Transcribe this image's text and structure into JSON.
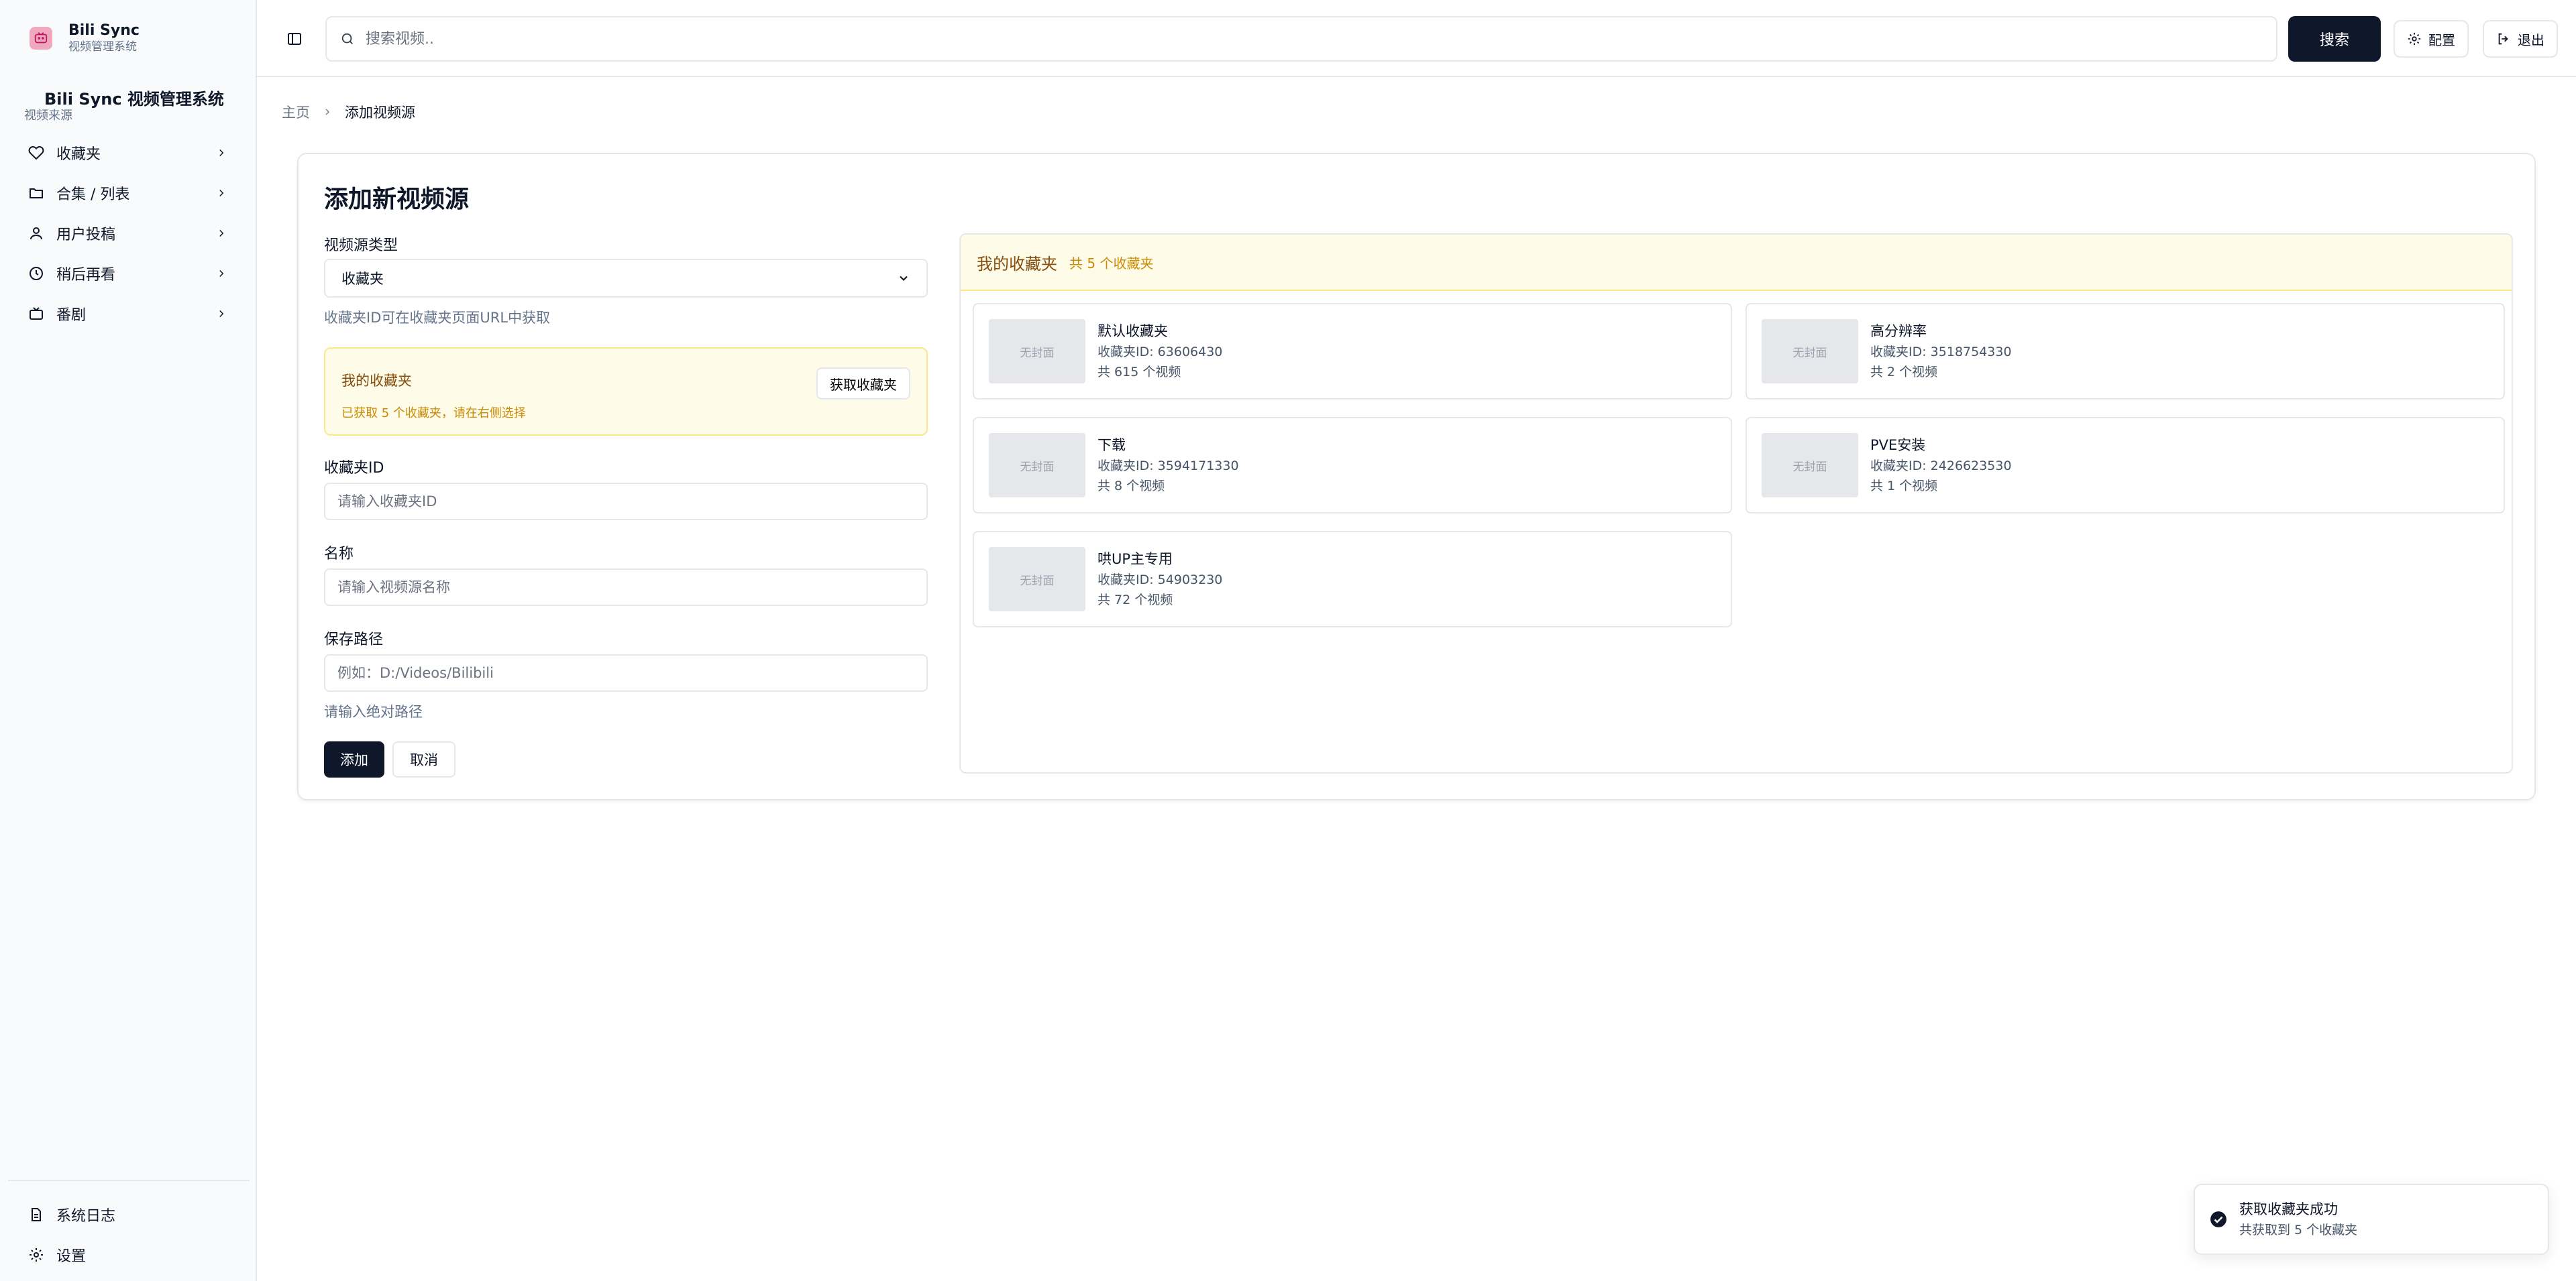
{
  "brand": {
    "title": "Bili Sync",
    "subtitle": "视频管理系统"
  },
  "sidebar": {
    "system_title": "Bili Sync 视频管理系统",
    "group_label": "视频来源",
    "items": [
      {
        "label": "收藏夹",
        "icon": "heart-icon"
      },
      {
        "label": "合集 / 列表",
        "icon": "folder-icon"
      },
      {
        "label": "用户投稿",
        "icon": "user-icon"
      },
      {
        "label": "稍后再看",
        "icon": "clock-icon"
      },
      {
        "label": "番剧",
        "icon": "tv-icon"
      }
    ],
    "bottom_items": [
      {
        "label": "系统日志",
        "icon": "file-text-icon"
      },
      {
        "label": "设置",
        "icon": "gear-icon"
      }
    ]
  },
  "header": {
    "search_placeholder": "搜索视频..",
    "search_button": "搜索",
    "config_button": "配置",
    "logout_button": "退出"
  },
  "breadcrumb": {
    "home": "主页",
    "current": "添加视频源"
  },
  "form": {
    "title": "添加新视频源",
    "source_type_label": "视频源类型",
    "source_type_value": "收藏夹",
    "source_type_hint": "收藏夹ID可在收藏夹页面URL中获取",
    "my_favorites_title": "我的收藏夹",
    "my_favorites_hint": "已获取 5 个收藏夹，请在右侧选择",
    "fetch_button": "获取收藏夹",
    "id_label": "收藏夹ID",
    "id_placeholder": "请输入收藏夹ID",
    "name_label": "名称",
    "name_placeholder": "请输入视频源名称",
    "path_label": "保存路径",
    "path_placeholder": "例如：D:/Videos/Bilibili",
    "path_hint": "请输入绝对路径",
    "add_button": "添加",
    "cancel_button": "取消"
  },
  "favorites": {
    "title": "我的收藏夹",
    "count_text": "共 5 个收藏夹",
    "no_cover": "无封面",
    "items": [
      {
        "name": "默认收藏夹",
        "id_text": "收藏夹ID: 63606430",
        "count_text": "共 615 个视频"
      },
      {
        "name": "高分辨率",
        "id_text": "收藏夹ID: 3518754330",
        "count_text": "共 2 个视频"
      },
      {
        "name": "下载",
        "id_text": "收藏夹ID: 3594171330",
        "count_text": "共 8 个视频"
      },
      {
        "name": "PVE安装",
        "id_text": "收藏夹ID: 2426623530",
        "count_text": "共 1 个视频"
      },
      {
        "name": "哄UP主专用",
        "id_text": "收藏夹ID: 54903230",
        "count_text": "共 72 个视频"
      }
    ]
  },
  "toast": {
    "title": "获取收藏夹成功",
    "description": "共获取到 5 个收藏夹"
  },
  "colors": {
    "primary": "#0f172a",
    "brand_pink": "#f0a8bf",
    "highlight_bg": "#fefce8",
    "highlight_text": "#854d0e"
  }
}
